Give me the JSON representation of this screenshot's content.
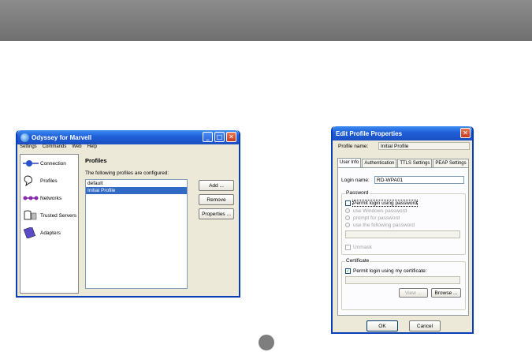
{
  "odyssey": {
    "title": "Odyssey for Marvell",
    "menu": [
      "Settings",
      "Commands",
      "Web",
      "Help"
    ],
    "sidebar": [
      "Connection",
      "Profiles",
      "Networks",
      "Trusted Servers",
      "Adapters"
    ],
    "heading": "Profiles",
    "caption": "The following profiles are configured:",
    "profiles": [
      "default",
      "Initial Profile"
    ],
    "buttons": {
      "add": "Add ...",
      "remove": "Remove",
      "properties": "Properties ..."
    }
  },
  "edit": {
    "title": "Edit Profile Properties",
    "profile_name_label": "Profile name:",
    "profile_name_value": "Initial Profile",
    "tabs": [
      "User Info",
      "Authentication",
      "TTLS Settings",
      "PEAP Settings"
    ],
    "login_label": "Login name:",
    "login_value": "RD-WPA01",
    "password_group": "Password",
    "permit_password": "Permit login using password",
    "use_windows": "use Windows password",
    "prompt": "prompt for password",
    "use_following": "use the following password",
    "unmask": "Unmask",
    "certificate_group": "Certificate",
    "permit_cert": "Permit login using my certificate:",
    "view": "View ...",
    "browse": "Browse ...",
    "ok": "OK",
    "cancel": "Cancel"
  },
  "colors": {
    "band": "#7a7a7a",
    "xp_blue": "#1f5fd9",
    "selection": "#316ac5"
  }
}
